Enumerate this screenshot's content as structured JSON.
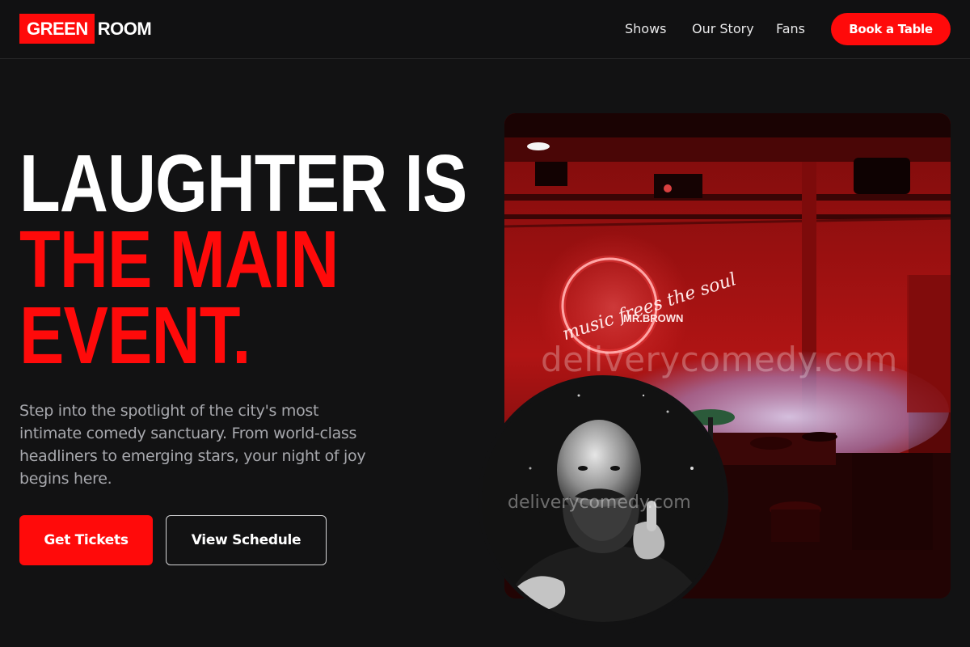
{
  "header": {
    "logo": {
      "part1": "GREEN",
      "part2": "ROOM"
    },
    "nav": [
      "Shows",
      "Our Story",
      "Fans"
    ],
    "cta": "Book a Table"
  },
  "hero": {
    "headline": {
      "line1": "LAUGHTER IS",
      "line2": "THE MAIN",
      "line3": "EVENT."
    },
    "lede": "Step into the spotlight of the city's most intimate comedy sanctuary. From world-class headliners to emerging stars, your night of joy begins here.",
    "primary_button": "Get Tickets",
    "secondary_button": "View Schedule"
  },
  "media": {
    "neon_sign_text": "music frees the soul",
    "neon_sign_subtext": "MR.BROWN",
    "watermark": "deliverycomedy.com"
  },
  "colors": {
    "accent": "#ff0a0a",
    "background": "#121213",
    "text_muted": "#a7a8ad"
  }
}
